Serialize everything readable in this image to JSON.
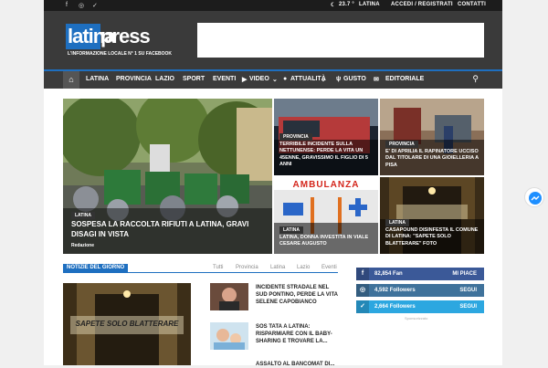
{
  "topbar": {
    "social_icons": [
      "facebook-icon",
      "instagram-icon",
      "twitter-icon"
    ],
    "temperature": "23.7 °",
    "city": "LATINA",
    "login": "ACCEDI / REGISTRATI",
    "contacts": "CONTATTI"
  },
  "header": {
    "logo_part1": "latina",
    "logo_part2": "press",
    "tagline": "L'INFORMAZIONE LOCALE N° 1 SU FACEBOOK"
  },
  "nav": {
    "items": [
      "LATINA",
      "PROVINCIA",
      "LAZIO",
      "SPORT",
      "EVENTI",
      "VIDEO",
      "ATTUALITÀ",
      "GUSTO",
      "EDITORIALE"
    ]
  },
  "featured": [
    {
      "category": "LATINA",
      "title": "SOSPESA LA RACCOLTA RIFIUTI A LATINA, GRAVI DISAGI IN VISTA",
      "author": "Redazione"
    },
    {
      "category": "PROVINCIA",
      "title": "TERRIBILE INCIDENTE SULLA NETTUNENSE: PERDE LA VITA UN 45ENNE, GRAVISSIMO IL FIGLIO DI 5 ANNI"
    },
    {
      "category": "PROVINCIA",
      "title": "E' DI APRILIA IL RAPINATORE UCCISO DAL TITOLARE DI UNA GIOIELLERIA A PISA"
    },
    {
      "category": "LATINA",
      "title": "LATINA, DONNA INVESTITA IN VIALE CESARE AUGUSTO"
    },
    {
      "category": "LATINA",
      "title": "CASAPOUND DISINFESTA IL COMUNE DI LATINA: \"SAPETE SOLO BLATTERARE\" FOTO"
    }
  ],
  "news_section": {
    "label": "NOTIZIE DEL GIORNO",
    "tabs": [
      "Tutti",
      "Provincia",
      "Latina",
      "Lazio",
      "Eventi"
    ],
    "graffiti": "SAPETE SOLO BLATTERARE",
    "items": [
      {
        "title": "INCIDENTE STRADALE NEL SUD PONTINO, PERDE LA VITA SELENE CAPOBIANCO"
      },
      {
        "title": "SOS TATA A LATINA: RISPARMIARE CON IL BABY-SHARING E TROVARE LA..."
      },
      {
        "title": "ASSALTO AL BANCOMAT DI..."
      }
    ]
  },
  "social": [
    {
      "count": "82,854",
      "unit": "Fan",
      "action": "MI PIACE",
      "color": "#3b5998",
      "icon": "facebook-icon"
    },
    {
      "count": "4,592",
      "unit": "Followers",
      "action": "SEGUI",
      "color": "#3f729b",
      "icon": "instagram-icon"
    },
    {
      "count": "2,664",
      "unit": "Followers",
      "action": "SEGUI",
      "color": "#2ca7e0",
      "icon": "twitter-icon"
    }
  ],
  "sponsor": "Sponsorizzato",
  "colors": {
    "accent": "#1e6fc0",
    "dark": "#3a3a3a"
  }
}
